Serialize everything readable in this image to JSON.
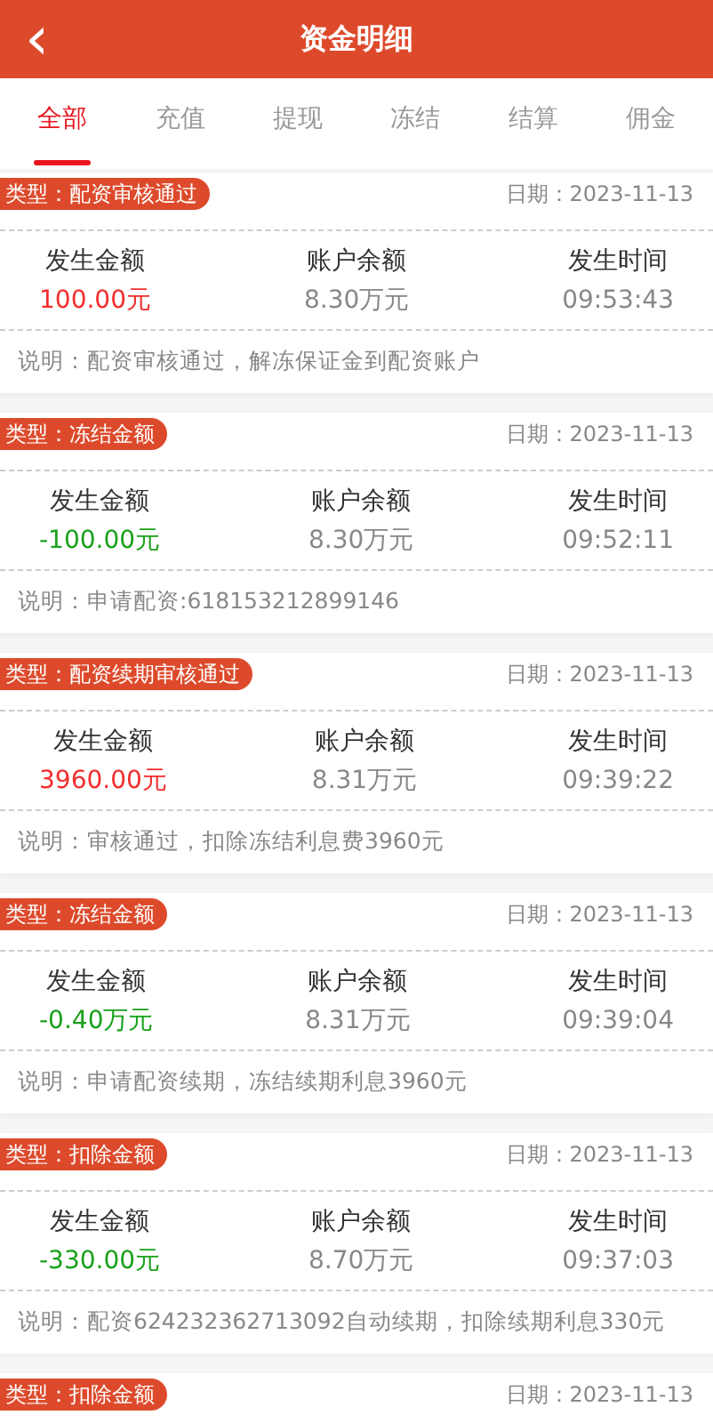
{
  "header": {
    "back": "‹",
    "title": "资金明细"
  },
  "tabs": [
    {
      "label": "全部",
      "selected": true
    },
    {
      "label": "充值",
      "selected": false
    },
    {
      "label": "提现",
      "selected": false
    },
    {
      "label": "冻结",
      "selected": false
    },
    {
      "label": "结算",
      "selected": false
    },
    {
      "label": "佣金",
      "selected": false
    }
  ],
  "records": [
    {
      "type": "类型：配资审核通过",
      "date": "日期：2023-11-13",
      "amount_label": "发生金额",
      "amount": "100.00元",
      "color": "#f32c2c",
      "balance_label": "账户余额",
      "balance": "8.30万元",
      "time_label": "发生时间",
      "time": "09:53:43",
      "note": "说明：配资审核通过，解冻保证金到配资账户"
    },
    {
      "type": "类型：冻结金额",
      "date": "日期：2023-11-13",
      "amount_label": "发生金额",
      "amount": "-100.00元",
      "color": "#1aa01a",
      "balance_label": "账户余额",
      "balance": "8.30万元",
      "time_label": "发生时间",
      "time": "09:52:11",
      "note": "说明：申请配资:618153212899146"
    },
    {
      "type": "类型：配资续期审核通过",
      "date": "日期：2023-11-13",
      "amount_label": "发生金额",
      "amount": "3960.00元",
      "color": "#f32c2c",
      "balance_label": "账户余额",
      "balance": "8.31万元",
      "time_label": "发生时间",
      "time": "09:39:22",
      "note": "说明：审核通过，扣除冻结利息费3960元"
    },
    {
      "type": "类型：冻结金额",
      "date": "日期：2023-11-13",
      "amount_label": "发生金额",
      "amount": "-0.40万元",
      "color": "#1aa01a",
      "balance_label": "账户余额",
      "balance": "8.31万元",
      "time_label": "发生时间",
      "time": "09:39:04",
      "note": "说明：申请配资续期，冻结续期利息3960元"
    },
    {
      "type": "类型：扣除金额",
      "date": "日期：2023-11-13",
      "amount_label": "发生金额",
      "amount": "-330.00元",
      "color": "#1aa01a",
      "balance_label": "账户余额",
      "balance": "8.70万元",
      "time_label": "发生时间",
      "time": "09:37:03",
      "note": "说明：配资624232362713092自动续期，扣除续期利息330元"
    },
    {
      "type": "类型：扣除金额",
      "date": "日期：2023-11-13"
    }
  ]
}
